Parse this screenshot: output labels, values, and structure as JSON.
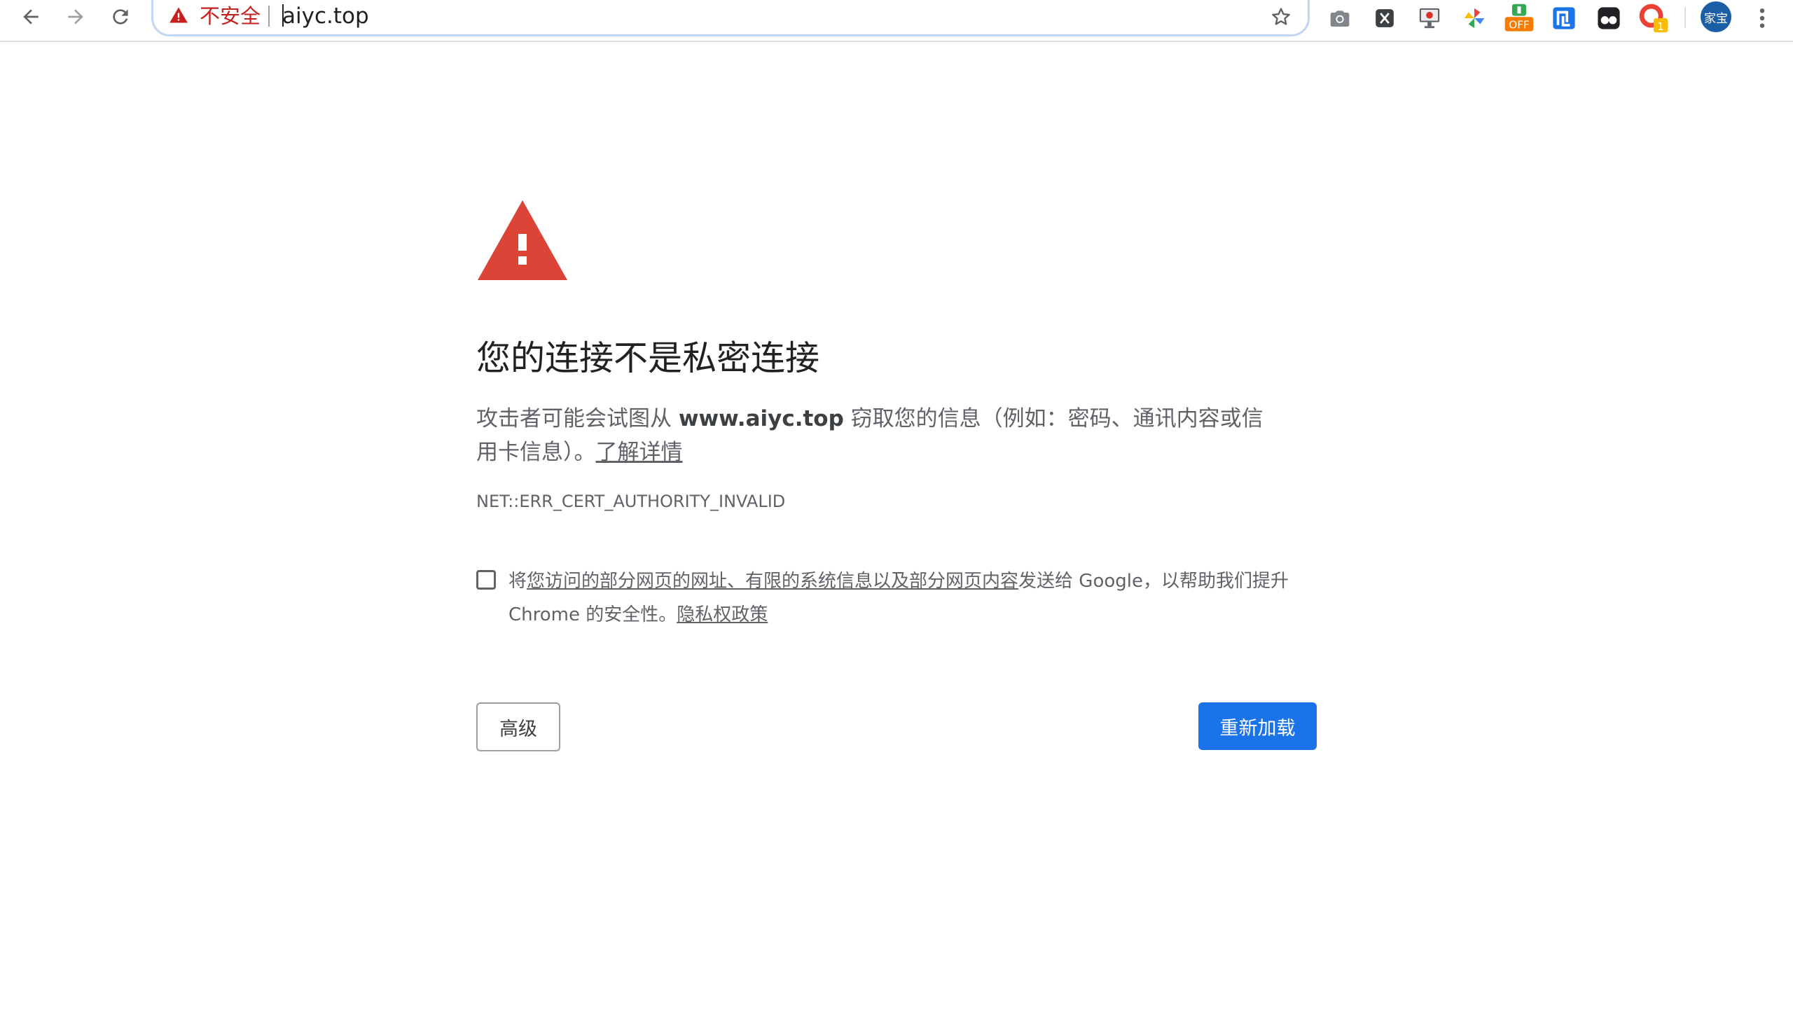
{
  "toolbar": {
    "back_icon": "back-arrow-icon",
    "forward_icon": "forward-arrow-icon",
    "reload_icon": "reload-icon",
    "omnibox": {
      "security_label": "不安全",
      "url": "aiyc.top",
      "warning_color": "#c5221f"
    },
    "extensions": [
      {
        "name": "camera-icon"
      },
      {
        "name": "x-extension-icon"
      },
      {
        "name": "screen-recorder-icon"
      },
      {
        "name": "pinwheel-icon"
      },
      {
        "name": "off-extension-icon",
        "badge": "OFF"
      },
      {
        "name": "bracket-extension-icon"
      },
      {
        "name": "tampermonkey-icon"
      },
      {
        "name": "notification-extension-icon",
        "badge": "1"
      }
    ],
    "profile": {
      "label": "家宝"
    }
  },
  "interstitial": {
    "heading": "您的连接不是私密连接",
    "desc_prefix": "攻击者可能会试图从 ",
    "desc_host": "www.aiyc.top",
    "desc_suffix": " 窃取您的信息（例如：密码、通讯内容或信用卡信息）。",
    "learn_more": "了解详情",
    "error_code": "NET::ERR_CERT_AUTHORITY_INVALID",
    "optin_prefix": "将",
    "optin_link": "您访问的部分网页的网址、有限的系统信息以及部分网页内容",
    "optin_middle": "发送给 Google，以帮助我们提升 Chrome 的安全性。",
    "privacy_link": "隐私权政策",
    "advanced_button": "高级",
    "reload_button": "重新加载"
  },
  "colors": {
    "accent": "#1a73e8",
    "warning_red": "#db4437",
    "text_secondary": "#5f6368"
  }
}
